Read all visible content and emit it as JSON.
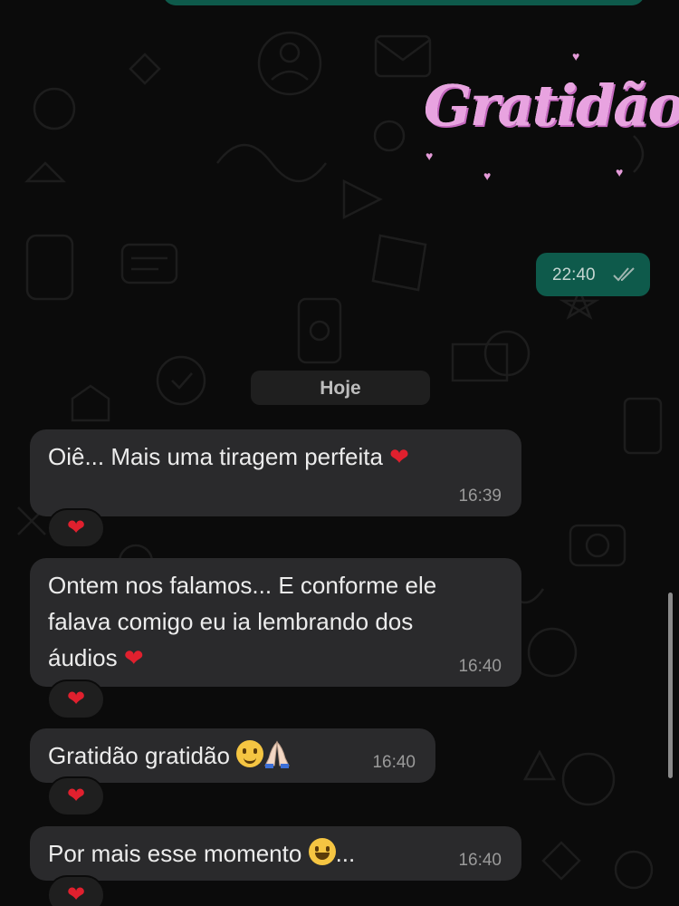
{
  "colors": {
    "background": "#0b0b0b",
    "incoming_bubble": "#2a2a2c",
    "outgoing_bubble": "#0e5a4b",
    "reaction_heart": "#e0202e",
    "sticker_pink": "#e8a3e0"
  },
  "sticker": {
    "text": "Gratidão"
  },
  "outgoing": {
    "time": "22:40",
    "status_icon": "double-check-icon"
  },
  "date_divider": {
    "label": "Hoje"
  },
  "messages": [
    {
      "text": "Oiê... Mais uma tiragem perfeita",
      "time": "16:39",
      "reaction": "red-heart"
    },
    {
      "text": "Ontem nos falamos... E conforme ele\nfalava comigo eu ia lembrando dos\náudios",
      "time": "16:40",
      "reaction": "red-heart"
    },
    {
      "text": "Gratidão gratidão",
      "time": "16:40",
      "reaction": "red-heart"
    },
    {
      "text": "Por mais esse momento",
      "text_suffix": "...",
      "time": "16:40",
      "reaction": "red-heart"
    }
  ]
}
